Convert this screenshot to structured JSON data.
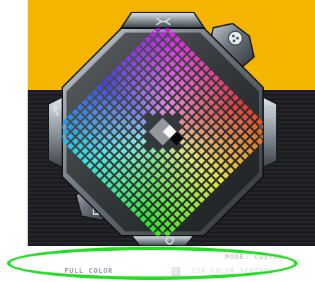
{
  "palette": {
    "title_icon": "scissors-icon",
    "top_right_icon": "palette-icon",
    "right_icon": "target-icon",
    "left_icon": "cursor-icon",
    "bottom_left_icon": "grid-icon",
    "bottom_icon": "circle-icon"
  },
  "footer": {
    "mode_label": "MODE: CUSTOM",
    "full_color_label": "FULL COLOR",
    "scheme_label": "256 COLOR SCHEME"
  },
  "colors": {
    "accent_yellow": "#f7b900",
    "dark_panel": "#1b1b1f",
    "highlight_green": "#22dd22"
  }
}
